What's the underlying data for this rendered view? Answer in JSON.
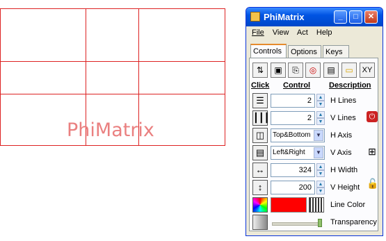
{
  "watermark": "PhiMatrix",
  "window": {
    "title": "PhiMatrix",
    "buttons": {
      "minimize": "_",
      "maximize": "□",
      "close": "✕"
    }
  },
  "menu": {
    "items": [
      "File",
      "View",
      "Act",
      "Help"
    ]
  },
  "tabs": [
    {
      "label": "Controls",
      "active": true
    },
    {
      "label": "Options",
      "active": false
    },
    {
      "label": "Keys",
      "active": false
    }
  ],
  "toolbar": {
    "icons": [
      "up-down-icon",
      "camera-icon",
      "copy-icon",
      "stop-icon",
      "save-icon",
      "open-folder-icon",
      "xy-icon"
    ],
    "xy_label": "XY"
  },
  "headers": {
    "click": "Click",
    "control": "Control",
    "description": "Description"
  },
  "controls": [
    {
      "icon": "h-lines-icon",
      "value": "2",
      "type": "number",
      "description": "H Lines"
    },
    {
      "icon": "v-lines-icon",
      "value": "2",
      "type": "number",
      "description": "V Lines"
    },
    {
      "icon": "h-axis-icon",
      "value": "Top&Bottom",
      "type": "select",
      "description": "H Axis"
    },
    {
      "icon": "v-axis-icon",
      "value": "Left&Right",
      "type": "select",
      "description": "V Axis"
    },
    {
      "icon": "h-width-icon",
      "value": "324",
      "type": "number",
      "description": "H Width"
    },
    {
      "icon": "v-height-icon",
      "value": "200",
      "type": "number",
      "description": "V Height"
    },
    {
      "icon": "color-wheel-icon",
      "value": "#ff0000",
      "type": "color",
      "description": "Line Color"
    },
    {
      "icon": "transparency-icon",
      "value": "1.0",
      "type": "slider",
      "description": "Transparency"
    }
  ],
  "side_icons": [
    "power-icon",
    "grid-icon",
    "lock-icon"
  ],
  "colors": {
    "grid_line": "#dd2222",
    "line_color": "#ff0000",
    "title_bar": "#0054e3"
  }
}
